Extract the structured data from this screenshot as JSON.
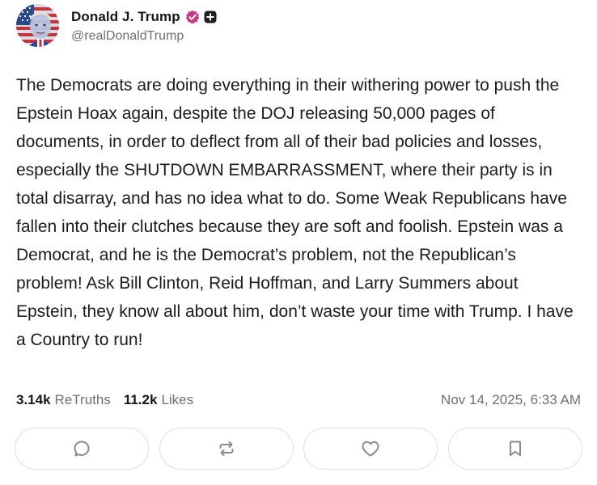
{
  "author": {
    "display_name": "Donald J. Trump",
    "handle": "@realDonaldTrump",
    "avatar_icon": "avatar-flag-portrait",
    "verified_icon": "verified-badge-icon",
    "badge_icon": "plus-badge-icon"
  },
  "post": {
    "text": "The Democrats are doing everything in their withering power to push the Epstein Hoax again, despite the DOJ releasing 50,000 pages of documents, in order to deflect from all of their bad policies and losses, especially the SHUTDOWN EMBARRASSMENT, where their party is in total disarray, and has no idea what to do. Some Weak Republicans have fallen into their clutches because they are soft and foolish. Epstein was a Democrat, and he is the Democrat’s problem, not the Republican’s problem! Ask Bill Clinton, Reid Hoffman, and Larry Summers about Epstein, they know all about him, don’t waste your time with Trump. I have a Country to run!"
  },
  "stats": {
    "retruths_count": "3.14k",
    "retruths_label": "ReTruths",
    "likes_count": "11.2k",
    "likes_label": "Likes",
    "timestamp": "Nov 14, 2025, 6:33 AM"
  },
  "actions": [
    {
      "icon": "reply-icon"
    },
    {
      "icon": "retruth-icon"
    },
    {
      "icon": "like-icon"
    },
    {
      "icon": "bookmark-icon"
    }
  ],
  "colors": {
    "verified": "#c43c87",
    "muted_text": "#6f6f78",
    "border": "#dedee4",
    "icon": "#8a8a94"
  }
}
